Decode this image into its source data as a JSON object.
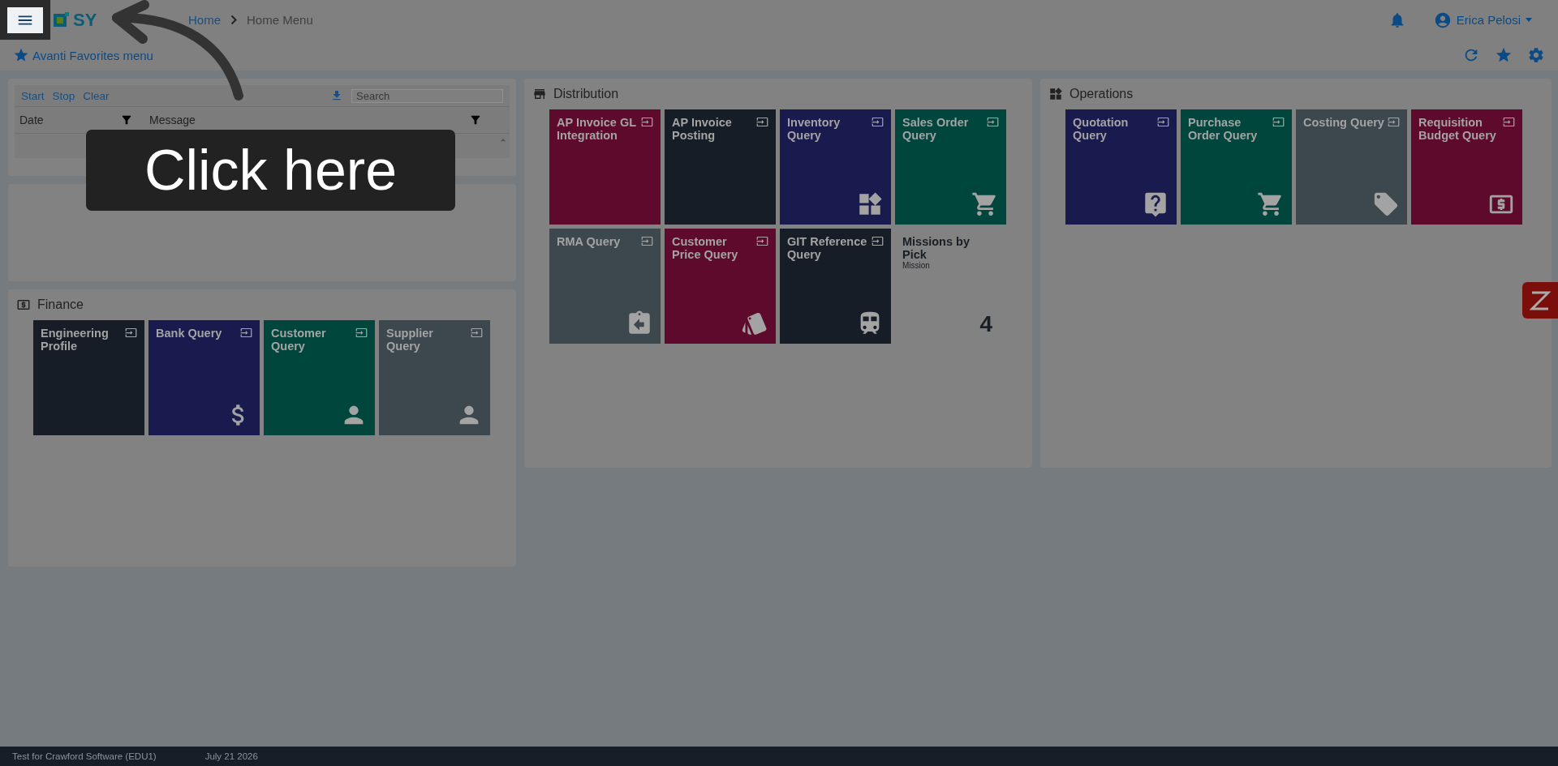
{
  "header": {
    "logo_text": "SY",
    "breadcrumb": [
      {
        "label": "Home",
        "kind": "link"
      },
      {
        "label": "Home Menu",
        "kind": "current"
      }
    ],
    "user": "Erica Pelosi"
  },
  "favorites": {
    "label": "Avanti Favorites menu"
  },
  "log": {
    "actions": [
      "Start",
      "Stop",
      "Clear"
    ],
    "search": {
      "placeholder": "Search"
    },
    "columns": [
      "Date",
      "Message"
    ]
  },
  "finance": {
    "title": "Finance",
    "tiles": [
      {
        "label": "Engineering Profile",
        "color": "#161d27",
        "kind": "none"
      },
      {
        "label": "Bank Query",
        "color": "#191b4e",
        "kind": "dollar"
      },
      {
        "label": "Customer Query",
        "color": "#00463d",
        "kind": "person"
      },
      {
        "label": "Supplier Query",
        "color": "#3c474e",
        "kind": "person"
      }
    ]
  },
  "distribution": {
    "title": "Distribution",
    "tiles": [
      {
        "label": "AP Invoice GL Integration",
        "color": "#5e0a2c",
        "kind": "none"
      },
      {
        "label": "AP Invoice Posting",
        "color": "#161d27",
        "kind": "none"
      },
      {
        "label": "Inventory Query",
        "color": "#191b4e",
        "kind": "widgets"
      },
      {
        "label": "Sales Order Query",
        "color": "#00463d",
        "kind": "cart"
      },
      {
        "label": "RMA Query",
        "color": "#3c474e",
        "kind": "return"
      },
      {
        "label": "Customer Price Query",
        "color": "#5e0a2c",
        "kind": "swatch"
      },
      {
        "label": "GIT Reference Query",
        "color": "#161d27",
        "kind": "train"
      },
      {
        "label": "Missions by Pick",
        "kind": "counter",
        "subtitle": "Mission",
        "count": "4"
      }
    ]
  },
  "operations": {
    "title": "Operations",
    "tiles": [
      {
        "label": "Quotation Query",
        "color": "#191b4e",
        "kind": "help"
      },
      {
        "label": "Purchase Order Query",
        "color": "#00463d",
        "kind": "cart"
      },
      {
        "label": "Costing Query",
        "color": "#3c474e",
        "kind": "tag"
      },
      {
        "label": "Requisition Budget Query",
        "color": "#5e0a2c",
        "kind": "money"
      }
    ]
  },
  "status_bar": {
    "company": "Test for Crawford Software (EDU1)",
    "date": "July 21 2026"
  },
  "callout": {
    "text": "Click here"
  }
}
